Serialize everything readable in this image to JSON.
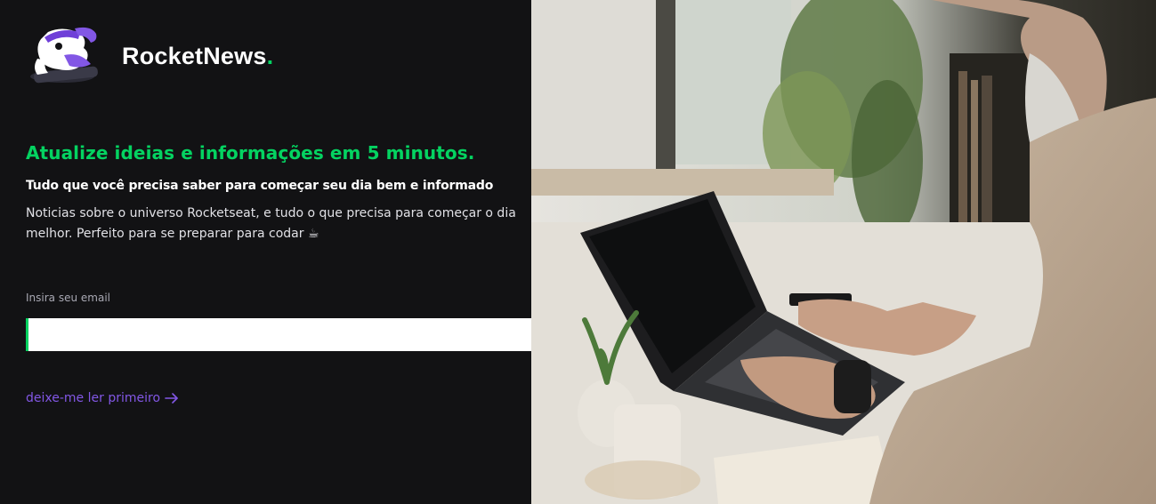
{
  "brand": {
    "name": "RocketNews",
    "dot": ".",
    "logo_icon": "rocket-mascot-icon"
  },
  "hero": {
    "headline": "Atualize ideias e informações em 5 minutos.",
    "subheadline": "Tudo que você precisa saber para começar seu dia bem e informado",
    "description": "Noticias sobre o universo Rocketseat, e tudo o que precisa para começar o dia melhor. Perfeito para se preparar para codar ☕"
  },
  "form": {
    "email_label": "Insira seu email",
    "email_value": "",
    "email_placeholder": "",
    "submit_icon": "send-icon"
  },
  "links": {
    "read_first": "deixe-me ler primeiro"
  },
  "colors": {
    "background": "#121214",
    "accent_green": "#04d361",
    "accent_purple": "#8257e5",
    "text": "#e1e1e6"
  },
  "photo": {
    "subject": "man-typing-on-laptop"
  }
}
